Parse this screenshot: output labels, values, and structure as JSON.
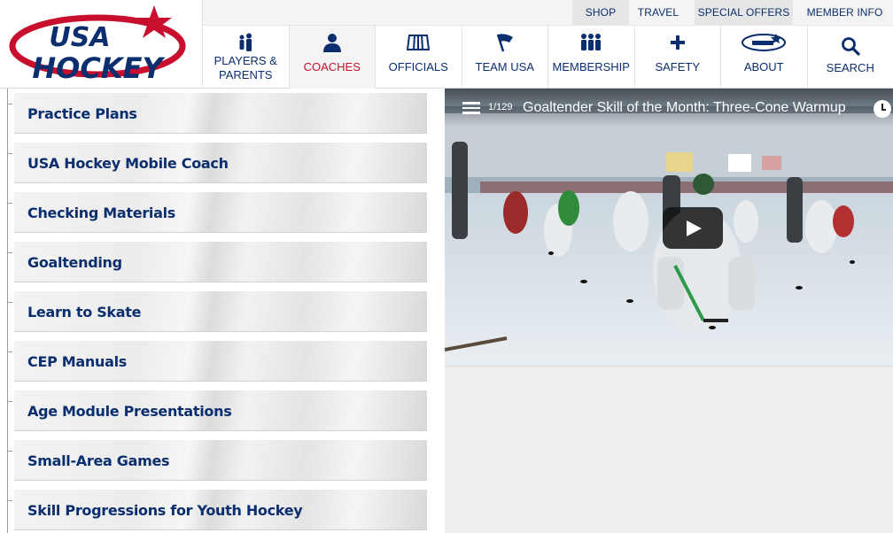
{
  "header": {
    "logo_alt": "USA Hockey",
    "logo_text_top": "USA",
    "logo_text_bottom": "HOCKEY",
    "utility_links": [
      {
        "label": "SHOP"
      },
      {
        "label": "TRAVEL"
      },
      {
        "label": "SPECIAL OFFERS"
      },
      {
        "label": "MEMBER INFO"
      }
    ],
    "nav": [
      {
        "label": "PLAYERS &\nPARENTS",
        "icon": "players-parents-icon"
      },
      {
        "label": "COACHES",
        "icon": "coach-icon",
        "active": true
      },
      {
        "label": "OFFICIALS",
        "icon": "officials-icon"
      },
      {
        "label": "TEAM USA",
        "icon": "flag-icon"
      },
      {
        "label": "MEMBERSHIP",
        "icon": "membership-icon"
      },
      {
        "label": "SAFETY",
        "icon": "cross-icon"
      },
      {
        "label": "ABOUT",
        "icon": "usa-hockey-mini-logo-icon"
      },
      {
        "label": "SEARCH",
        "icon": "search-icon"
      }
    ]
  },
  "sidebar": {
    "items": [
      {
        "label": "Practice Plans"
      },
      {
        "label": "USA Hockey Mobile Coach"
      },
      {
        "label": "Checking Materials"
      },
      {
        "label": "Goaltending"
      },
      {
        "label": "Learn to Skate"
      },
      {
        "label": "CEP Manuals"
      },
      {
        "label": "Age Module Presentations"
      },
      {
        "label": "Small-Area Games"
      },
      {
        "label": "Skill Progressions for Youth Hockey"
      }
    ]
  },
  "video": {
    "playlist_count": "1/129",
    "title": "Goaltender Skill of the Month: Three-Cone Warmup",
    "icons": [
      "playlist-icon",
      "watch-later-icon",
      "play-icon"
    ]
  },
  "colors": {
    "navy": "#0b2e6e",
    "red": "#c8102e",
    "util_bar": "#f4f4f4"
  }
}
